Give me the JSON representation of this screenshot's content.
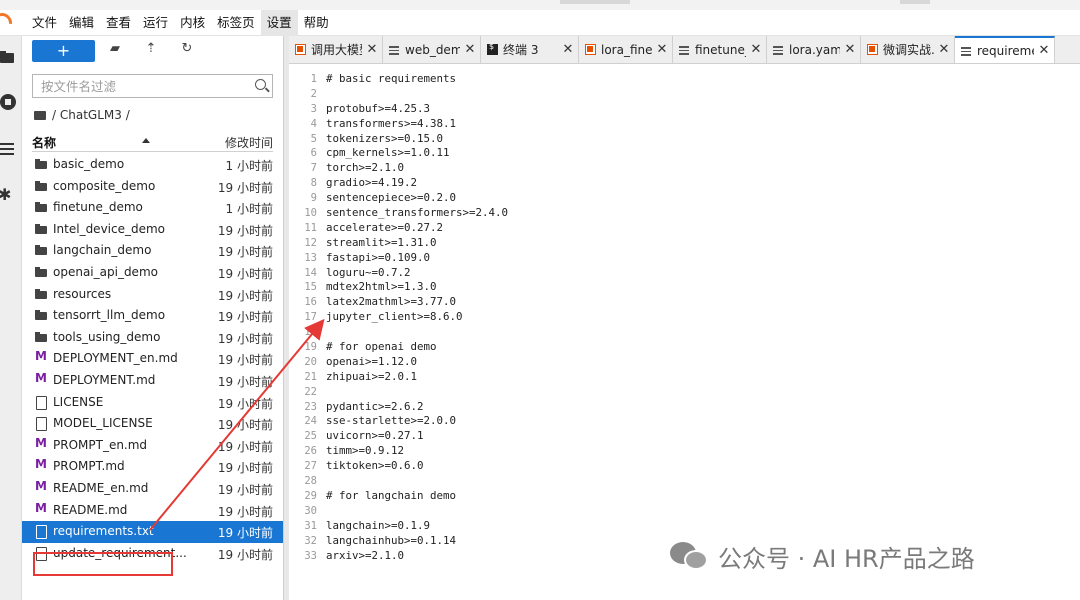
{
  "menu": [
    "文件",
    "编辑",
    "查看",
    "运行",
    "内核",
    "标签页",
    "设置",
    "帮助"
  ],
  "active_menu_index": 6,
  "toolbar": {
    "new_label": "+"
  },
  "filter": {
    "placeholder": "按文件名过滤"
  },
  "breadcrumb": "/ ChatGLM3 /",
  "columns": {
    "name": "名称",
    "modified": "修改时间"
  },
  "files": [
    {
      "name": "basic_demo",
      "type": "folder",
      "time": "1 小时前"
    },
    {
      "name": "composite_demo",
      "type": "folder",
      "time": "19 小时前"
    },
    {
      "name": "finetune_demo",
      "type": "folder",
      "time": "1 小时前"
    },
    {
      "name": "Intel_device_demo",
      "type": "folder",
      "time": "19 小时前"
    },
    {
      "name": "langchain_demo",
      "type": "folder",
      "time": "19 小时前"
    },
    {
      "name": "openai_api_demo",
      "type": "folder",
      "time": "19 小时前"
    },
    {
      "name": "resources",
      "type": "folder",
      "time": "19 小时前"
    },
    {
      "name": "tensorrt_llm_demo",
      "type": "folder",
      "time": "19 小时前"
    },
    {
      "name": "tools_using_demo",
      "type": "folder",
      "time": "19 小时前"
    },
    {
      "name": "DEPLOYMENT_en.md",
      "type": "md",
      "time": "19 小时前"
    },
    {
      "name": "DEPLOYMENT.md",
      "type": "md",
      "time": "19 小时前"
    },
    {
      "name": "LICENSE",
      "type": "file",
      "time": "19 小时前"
    },
    {
      "name": "MODEL_LICENSE",
      "type": "file",
      "time": "19 小时前"
    },
    {
      "name": "PROMPT_en.md",
      "type": "md",
      "time": "19 小时前"
    },
    {
      "name": "PROMPT.md",
      "type": "md",
      "time": "19 小时前"
    },
    {
      "name": "README_en.md",
      "type": "md",
      "time": "19 小时前"
    },
    {
      "name": "README.md",
      "type": "md",
      "time": "19 小时前"
    },
    {
      "name": "requirements.txt",
      "type": "file",
      "time": "19 小时前",
      "selected": true
    },
    {
      "name": "update_requirement...",
      "type": "file",
      "time": "19 小时前"
    }
  ],
  "tabs": [
    {
      "label": "调用大模型",
      "icon": "notebook",
      "width": 94
    },
    {
      "label": "web_demo",
      "icon": "document",
      "width": 98
    },
    {
      "label": "终端 3",
      "icon": "terminal",
      "width": 98
    },
    {
      "label": "lora_finetu",
      "icon": "notebook",
      "width": 94
    },
    {
      "label": "finetune_h",
      "icon": "document",
      "width": 94
    },
    {
      "label": "lora.yaml",
      "icon": "document",
      "width": 94
    },
    {
      "label": "微调实战.ip",
      "icon": "notebook",
      "width": 94
    },
    {
      "label": "requiremer",
      "icon": "document",
      "width": 100,
      "active": true
    }
  ],
  "code_lines": [
    "# basic requirements",
    "",
    "protobuf>=4.25.3",
    "transformers>=4.38.1",
    "tokenizers>=0.15.0",
    "cpm_kernels>=1.0.11",
    "torch>=2.1.0",
    "gradio>=4.19.2",
    "sentencepiece>=0.2.0",
    "sentence_transformers>=2.4.0",
    "accelerate>=0.27.2",
    "streamlit>=1.31.0",
    "fastapi>=0.109.0",
    "loguru~=0.7.2",
    "mdtex2html>=1.3.0",
    "latex2mathml>=3.77.0",
    "jupyter_client>=8.6.0",
    "",
    "# for openai demo",
    "openai>=1.12.0",
    "zhipuai>=2.0.1",
    "",
    "pydantic>=2.6.2",
    "sse-starlette>=2.0.0",
    "uvicorn>=0.27.1",
    "timm>=0.9.12",
    "tiktoken>=0.6.0",
    "",
    "# for langchain demo",
    "",
    "langchain>=0.1.9",
    "langchainhub>=0.1.14",
    "arxiv>=2.1.0"
  ],
  "watermark": "公众号 · AI HR产品之路",
  "colors": {
    "accent": "#1976d2",
    "annotation": "#e53935",
    "notebook_icon": "#e65100",
    "markdown_icon": "#7b1fa2"
  }
}
